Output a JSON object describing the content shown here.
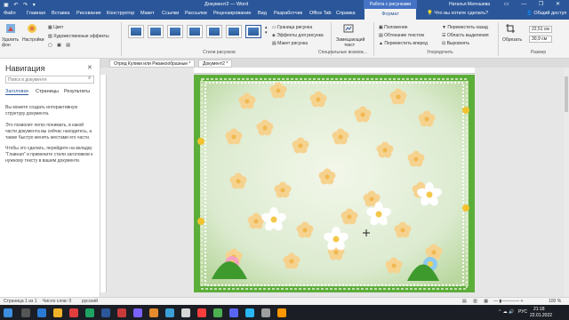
{
  "titlebar": {
    "doc_title": "Документ2 — Word",
    "context_tab": "Работа с рисунками",
    "user": "Наталья Матюшева",
    "tell_me": "Что вы хотите сделать?",
    "share": "Общий доступ"
  },
  "tabs": [
    "Файл",
    "Главная",
    "Вставка",
    "Рисование",
    "Конструктор",
    "Макет",
    "Ссылки",
    "Рассылки",
    "Рецензирование",
    "Вид",
    "Разработчик",
    "Office Tab",
    "Справка",
    "Формат"
  ],
  "active_tab": "Формат",
  "ribbon": {
    "remove_bg": "Удалить фон",
    "corrections": "Настройки",
    "color": "Цвет",
    "artistic": "Художественные эффекты",
    "pic_styles_label": "Стили рисунков",
    "border": "Граница рисунка",
    "effects": "Эффекты для рисунка",
    "layout": "Макет рисунка",
    "alt_text": "Замещающий текст",
    "special_label": "Специальные возмож...",
    "position": "Положение",
    "wrap": "Обтекание текстом",
    "bring_forward": "Переместить вперед",
    "send_back": "Переместить назад",
    "selection_pane": "Область выделения",
    "align": "Выровнять",
    "arrange_label": "Упорядочить",
    "crop": "Обрезать",
    "height": "22,51 см",
    "width": "30,9 см",
    "size_label": "Размер"
  },
  "nav": {
    "title": "Навигация",
    "search_placeholder": "Поиск в документе",
    "tab_headings": "Заголовки",
    "tab_pages": "Страницы",
    "tab_results": "Результаты",
    "para1": "Вы можете создать интерактивную структуру документа.",
    "para2": "Это позволит легко понимать, в какой части документа вы сейчас находитесь, а также быстро менять местами его части.",
    "para3": "Чтобы это сделать, перейдите на вкладку \"Главная\" и примените стили заголовков к нужному тексту в вашем документе."
  },
  "doc_tabs": [
    "Отряд Кулики или Ржанкообразные *",
    "Документ2 *"
  ],
  "status": {
    "page": "Страница 1 из 1",
    "words": "Число слов: 0",
    "lang": "русский",
    "zoom": "100 %"
  },
  "taskbar": {
    "lang": "РУС",
    "time": "21:18",
    "date": "22.01.2022"
  },
  "colors": {
    "word_blue": "#2b579a",
    "page_bg": "#dfeed6",
    "border_green": "#5cae3a"
  }
}
